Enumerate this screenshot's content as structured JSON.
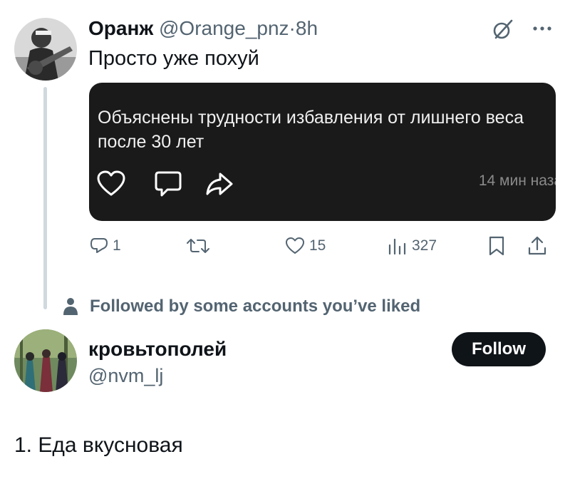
{
  "tweet": {
    "display_name": "Оранж",
    "handle": "@Orange_pnz",
    "separator": "·",
    "time": "8h",
    "text": "Просто уже похуй",
    "embed": {
      "title": "Объяснены трудности избавления от лишнего веса после 30 лет",
      "time_ago": "14 мин наза"
    },
    "actions": {
      "replies": "1",
      "retweets": "",
      "likes": "15",
      "views": "327"
    }
  },
  "followed_by": "Followed by some accounts you’ve liked",
  "suggested_user": {
    "display_name": "кровьтополей",
    "handle": "@nvm_lj",
    "follow_label": "Follow"
  },
  "bio": "1. Еда вкусновая",
  "icons": {
    "grok": "grok-slash-icon",
    "more": "more-dots-icon",
    "reply": "reply-icon",
    "retweet": "retweet-icon",
    "like": "heart-icon",
    "views": "views-chart-icon",
    "bookmark": "bookmark-icon",
    "share": "share-upload-icon",
    "followed": "person-icon"
  },
  "colors": {
    "text": "#0f1419",
    "muted": "#536471",
    "embed_bg": "#1a1a1a",
    "follow_button_bg": "#0f1419"
  }
}
